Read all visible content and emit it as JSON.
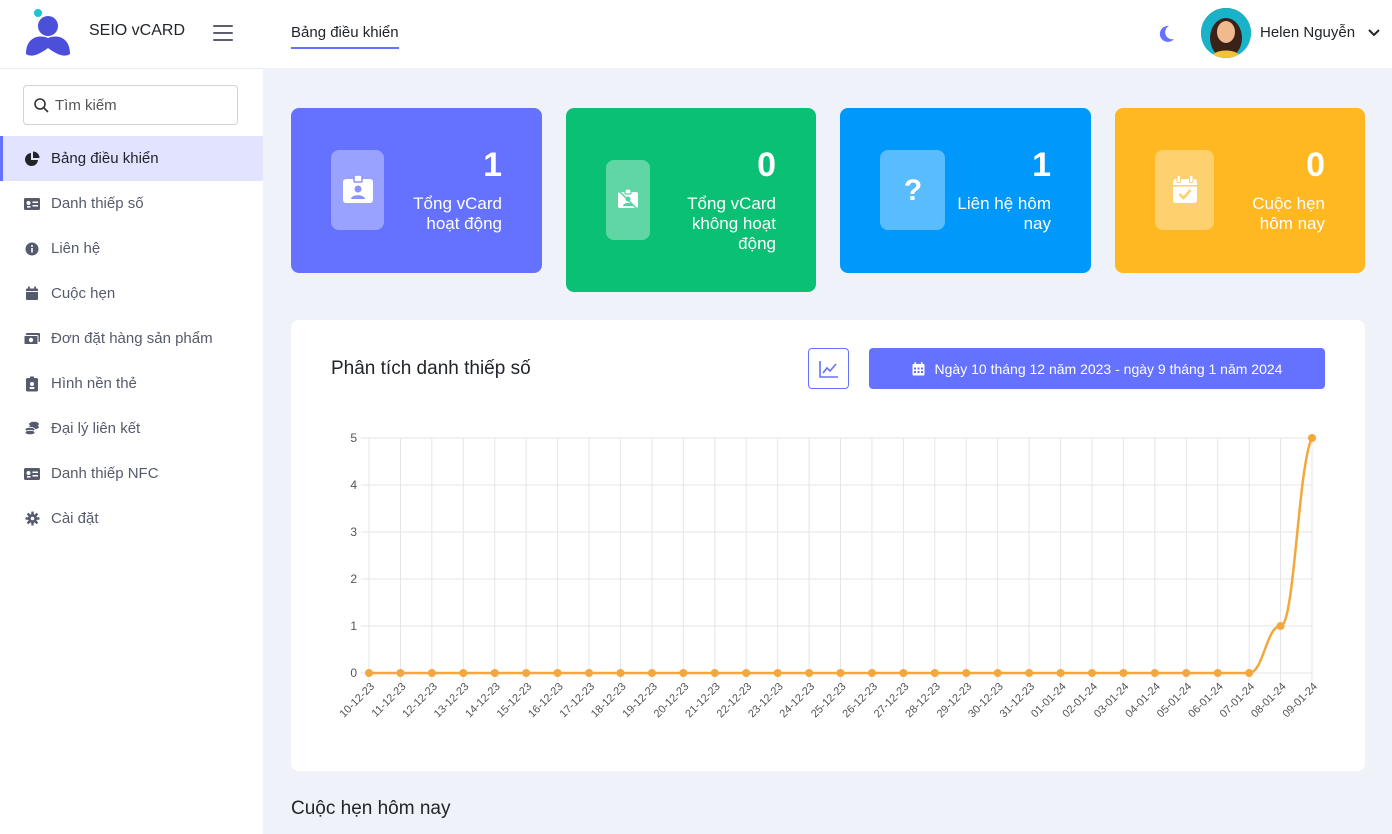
{
  "brand": {
    "name": "SEIO vCARD"
  },
  "header": {
    "tab": "Bảng điều khiển",
    "user_name": "Helen Nguyễn"
  },
  "sidebar": {
    "search_placeholder": "Tìm kiếm",
    "items": [
      {
        "label": "Bảng điều khiển",
        "icon": "pie-chart-icon",
        "active": true
      },
      {
        "label": "Danh thiếp số",
        "icon": "id-card-icon"
      },
      {
        "label": "Liên hệ",
        "icon": "info-circle-icon"
      },
      {
        "label": "Cuộc hẹn",
        "icon": "calendar-icon"
      },
      {
        "label": "Đơn đặt hàng sản phẩm",
        "icon": "money-icon"
      },
      {
        "label": "Hình nền thẻ",
        "icon": "id-badge-icon"
      },
      {
        "label": "Đại lý liên kết",
        "icon": "coins-icon"
      },
      {
        "label": "Danh thiếp NFC",
        "icon": "nfc-card-icon"
      },
      {
        "label": "Cài đặt",
        "icon": "gear-icon"
      }
    ]
  },
  "stats": [
    {
      "value": "1",
      "label_lines": [
        "Tổng vCard",
        "hoạt động"
      ],
      "color": "#6571ff",
      "icon": "badge-icon"
    },
    {
      "value": "0",
      "label_lines": [
        "Tổng vCard",
        "không hoạt",
        "động"
      ],
      "color": "#0ac074",
      "icon": "badge-off-icon"
    },
    {
      "value": "1",
      "label_lines": [
        "Liên hệ hôm",
        "nay"
      ],
      "color": "#0099fb",
      "icon": "question-icon"
    },
    {
      "value": "0",
      "label_lines": [
        "Cuộc hẹn",
        "hôm nay"
      ],
      "color": "#ffb821",
      "icon": "calendar-check-icon"
    }
  ],
  "analytics": {
    "title": "Phân tích danh thiếp số",
    "date_range": "Ngày 10 tháng 12 năm 2023 - ngày 9 tháng 1 năm 2024"
  },
  "appointments_title": "Cuộc hẹn hôm nay",
  "chart_data": {
    "type": "line",
    "categories": [
      "10-12-23",
      "11-12-23",
      "12-12-23",
      "13-12-23",
      "14-12-23",
      "15-12-23",
      "16-12-23",
      "17-12-23",
      "18-12-23",
      "19-12-23",
      "20-12-23",
      "21-12-23",
      "22-12-23",
      "23-12-23",
      "24-12-23",
      "25-12-23",
      "26-12-23",
      "27-12-23",
      "28-12-23",
      "29-12-23",
      "30-12-23",
      "31-12-23",
      "01-01-24",
      "02-01-24",
      "03-01-24",
      "04-01-24",
      "05-01-24",
      "06-01-24",
      "07-01-24",
      "08-01-24",
      "09-01-24"
    ],
    "values": [
      0,
      0,
      0,
      0,
      0,
      0,
      0,
      0,
      0,
      0,
      0,
      0,
      0,
      0,
      0,
      0,
      0,
      0,
      0,
      0,
      0,
      0,
      0,
      0,
      0,
      0,
      0,
      0,
      0,
      1,
      5
    ],
    "ylim": [
      0,
      5
    ],
    "yticks": [
      0,
      1,
      2,
      3,
      4,
      5
    ],
    "grid": true,
    "color": "#f4a73a"
  }
}
